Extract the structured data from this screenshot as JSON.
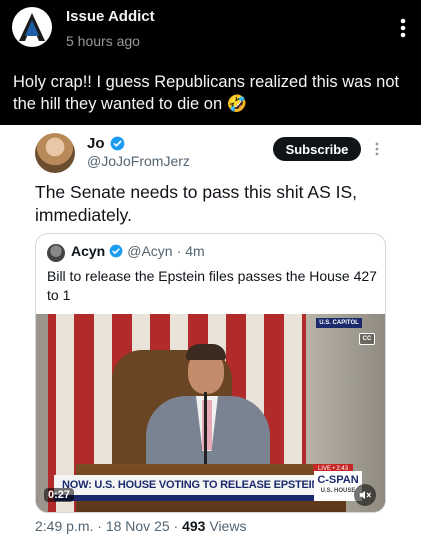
{
  "post": {
    "author": "Issue Addict",
    "time": "5 hours ago",
    "text": "Holy crap!! I guess Republicans realized this was not the hill they wanted to die on 🤣",
    "logo_letter": "A"
  },
  "tweet": {
    "name": "Jo",
    "handle": "@JoJoFromJerz",
    "subscribe_label": "Subscribe",
    "text": "The Senate needs to pass this shit AS IS, immediately.",
    "footer": {
      "time": "2:49 p.m.",
      "sep1": "·",
      "date": "18 Nov 25",
      "sep2": "·",
      "views_count": "493",
      "views_label": "Views"
    }
  },
  "quote": {
    "name": "Acyn",
    "handle": "@Acyn",
    "sep": "·",
    "age": "4m",
    "text": "Bill to release the Epstein files passes the House 427 to 1"
  },
  "video": {
    "duration": "0:27",
    "chyron": "NOW: U.S. HOUSE VOTING TO RELEASE EPSTEIN FILES",
    "network": "C-SPAN",
    "network_sub": "U.S. HOUSE",
    "live_label": "LIVE • 2:43",
    "location_badge": "U.S. CAPITOL",
    "cc_label": "CC"
  },
  "colors": {
    "verified": "#1d9bf0",
    "logo_blue": "#1e5fa8"
  }
}
